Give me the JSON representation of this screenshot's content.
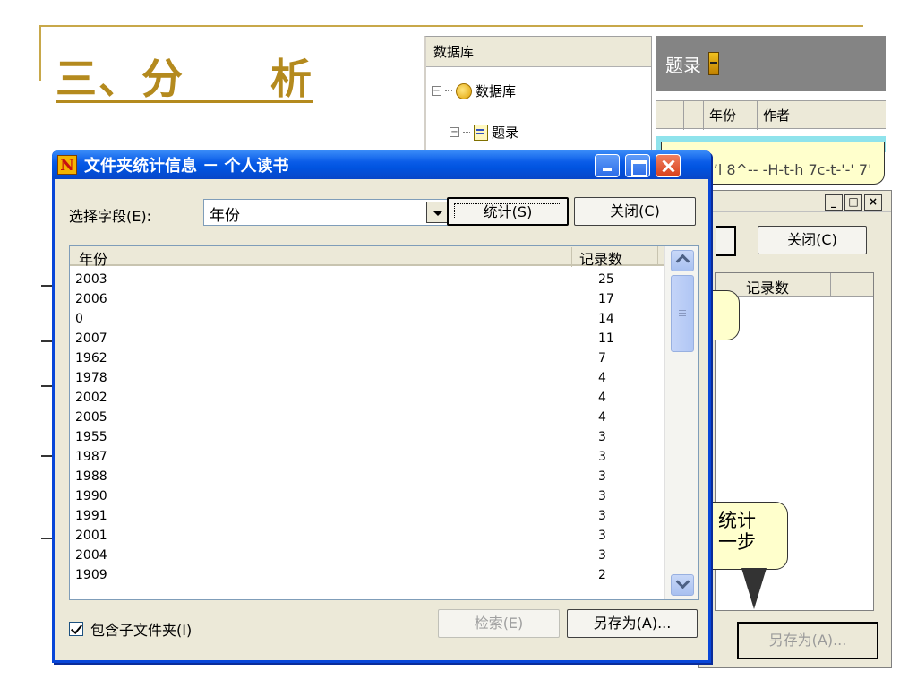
{
  "slide": {
    "title": "三、分　　析"
  },
  "tree_panel": {
    "header": "数据库",
    "root_label": "数据库",
    "child_label": "题录"
  },
  "records_panel": {
    "title": "题录",
    "columns": [
      "年份",
      "作者"
    ]
  },
  "callouts": {
    "top_text": "-’l 8^-- -H-t-h 7c-t-'-' 7'",
    "bottom_text_1": "统计",
    "bottom_text_2": "一步"
  },
  "bg_dialog": {
    "close_label": "关闭(C)",
    "column_count": "记录数",
    "saveas_label": "另存为(A)..."
  },
  "dialog": {
    "app_icon_letter": "N",
    "title": "文件夹统计信息 － 个人读书",
    "field_label": "选择字段(E):",
    "field_value": "年份",
    "stat_button": "统计(S)",
    "close_button": "关闭(C)",
    "columns": {
      "year": "年份",
      "count": "记录数"
    },
    "rows": [
      {
        "year": "2003",
        "count": "25"
      },
      {
        "year": "2006",
        "count": "17"
      },
      {
        "year": "0",
        "count": "14"
      },
      {
        "year": "2007",
        "count": "11"
      },
      {
        "year": "1962",
        "count": "7"
      },
      {
        "year": "1978",
        "count": "4"
      },
      {
        "year": "2002",
        "count": "4"
      },
      {
        "year": "2005",
        "count": "4"
      },
      {
        "year": "1955",
        "count": "3"
      },
      {
        "year": "1987",
        "count": "3"
      },
      {
        "year": "1988",
        "count": "3"
      },
      {
        "year": "1990",
        "count": "3"
      },
      {
        "year": "1991",
        "count": "3"
      },
      {
        "year": "2001",
        "count": "3"
      },
      {
        "year": "2004",
        "count": "3"
      },
      {
        "year": "1909",
        "count": "2"
      }
    ],
    "include_subfolders": "包含子文件夹(I)",
    "include_subfolders_checked": true,
    "search_button": "检索(E)",
    "saveas_button": "另存为(A)..."
  },
  "colors": {
    "titlebar_blue": "#0054e0",
    "slide_accent": "#b48a1e",
    "callout_fill": "#ffffcc",
    "records_highlight": "#8fe3ec"
  }
}
